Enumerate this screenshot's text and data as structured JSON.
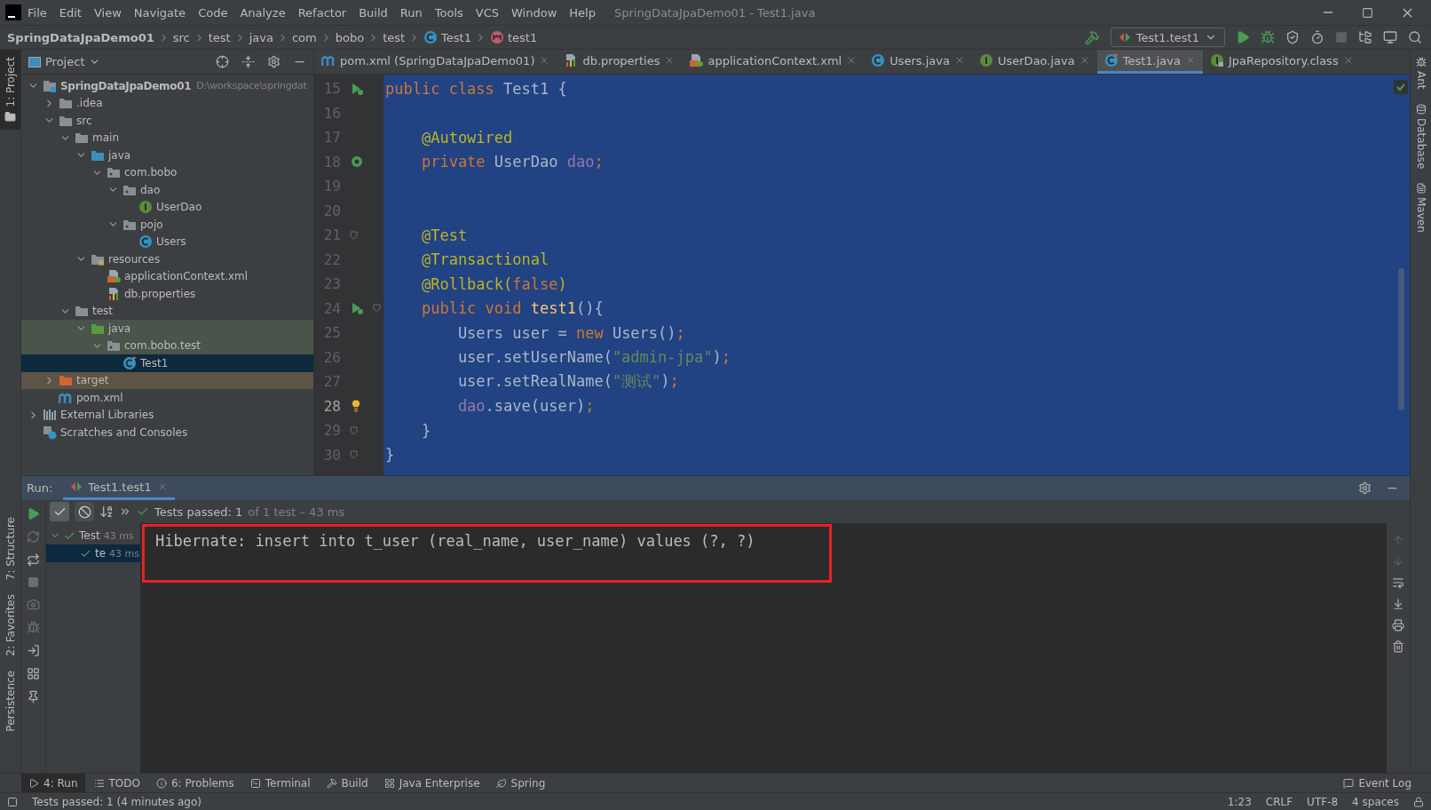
{
  "window": {
    "title": "SpringDataJpaDemo01 - Test1.java"
  },
  "menu": [
    "File",
    "Edit",
    "View",
    "Navigate",
    "Code",
    "Analyze",
    "Refactor",
    "Build",
    "Run",
    "Tools",
    "VCS",
    "Window",
    "Help"
  ],
  "breadcrumb": [
    {
      "label": "SpringDataJpaDemo01",
      "kind": "project"
    },
    {
      "label": "src",
      "kind": "dir"
    },
    {
      "label": "test",
      "kind": "dir"
    },
    {
      "label": "java",
      "kind": "dir"
    },
    {
      "label": "com",
      "kind": "dir"
    },
    {
      "label": "bobo",
      "kind": "dir"
    },
    {
      "label": "test",
      "kind": "dir"
    },
    {
      "label": "Test1",
      "kind": "class"
    },
    {
      "label": "test1",
      "kind": "method"
    }
  ],
  "run_config": {
    "label": "Test1.test1"
  },
  "left_tool_windows": [
    {
      "label": "1: Project",
      "at_bottom": false,
      "selected": true
    },
    {
      "label": "7: Structure",
      "at_bottom": true,
      "selected": false
    },
    {
      "label": "2: Favorites",
      "at_bottom": true,
      "selected": false
    },
    {
      "label": "Persistence",
      "at_bottom": true,
      "selected": false
    }
  ],
  "right_tool_windows": [
    {
      "label": "Ant",
      "kind": "ant"
    },
    {
      "label": "Database",
      "kind": "database"
    },
    {
      "label": "Maven",
      "kind": "maven"
    }
  ],
  "project_panel": {
    "title": "Project",
    "tree": [
      {
        "label": "SpringDataJpaDemo01",
        "hint": "D:\\workspace\\springdat",
        "kind": "module",
        "expanded": true,
        "selected": false,
        "children": [
          {
            "label": ".idea",
            "kind": "folder",
            "expanded": false,
            "selected": false
          },
          {
            "label": "src",
            "kind": "folder",
            "expanded": true,
            "selected": false,
            "children": [
              {
                "label": "main",
                "kind": "folder",
                "expanded": true,
                "selected": false,
                "children": [
                  {
                    "label": "java",
                    "kind": "source-root",
                    "expanded": true,
                    "selected": false,
                    "children": [
                      {
                        "label": "com.bobo",
                        "kind": "package",
                        "expanded": true,
                        "selected": false,
                        "children": [
                          {
                            "label": "dao",
                            "kind": "package",
                            "expanded": true,
                            "selected": false,
                            "children": [
                              {
                                "label": "UserDao",
                                "kind": "interface",
                                "selected": false
                              }
                            ]
                          },
                          {
                            "label": "pojo",
                            "kind": "package",
                            "expanded": true,
                            "selected": false,
                            "children": [
                              {
                                "label": "Users",
                                "kind": "class",
                                "selected": false
                              }
                            ]
                          }
                        ]
                      }
                    ]
                  },
                  {
                    "label": "resources",
                    "kind": "resource-root",
                    "expanded": true,
                    "selected": false,
                    "children": [
                      {
                        "label": "applicationContext.xml",
                        "kind": "xml",
                        "selected": false
                      },
                      {
                        "label": "db.properties",
                        "kind": "properties",
                        "selected": false
                      }
                    ]
                  }
                ]
              },
              {
                "label": "test",
                "kind": "folder",
                "expanded": true,
                "selected": false,
                "children": [
                  {
                    "label": "java",
                    "kind": "test-root",
                    "test_scope": true,
                    "expanded": true,
                    "selected": false,
                    "children": [
                      {
                        "label": "com.bobo.test",
                        "kind": "package",
                        "test_scope": true,
                        "expanded": true,
                        "selected": false,
                        "children": [
                          {
                            "label": "Test1",
                            "kind": "test-class",
                            "selected": true
                          }
                        ]
                      }
                    ]
                  }
                ]
              }
            ]
          },
          {
            "label": "target",
            "kind": "excluded-folder",
            "excluded": true,
            "expanded": false,
            "selected": false
          },
          {
            "label": "pom.xml",
            "kind": "maven",
            "selected": false
          }
        ]
      },
      {
        "label": "External Libraries",
        "kind": "libraries",
        "expanded": false,
        "selected": false
      },
      {
        "label": "Scratches and Consoles",
        "kind": "scratches",
        "selected": false
      }
    ]
  },
  "editor": {
    "tabs": [
      {
        "label": "pom.xml (SpringDataJpaDemo01)",
        "kind": "maven",
        "selected": false
      },
      {
        "label": "db.properties",
        "kind": "properties",
        "selected": false
      },
      {
        "label": "applicationContext.xml",
        "kind": "xml",
        "selected": false
      },
      {
        "label": "Users.java",
        "kind": "class",
        "selected": false
      },
      {
        "label": "UserDao.java",
        "kind": "interface",
        "selected": false
      },
      {
        "label": "Test1.java",
        "kind": "test-class",
        "selected": true
      },
      {
        "label": "JpaRepository.class",
        "kind": "locked-interface",
        "selected": false
      }
    ],
    "lines": [
      {
        "number": "15",
        "run_marker": true,
        "current": false,
        "tokens": [
          {
            "kind": "keyword",
            "text": "public class "
          },
          {
            "kind": "plain",
            "text": "Test1 {"
          }
        ]
      },
      {
        "number": "16",
        "current": false
      },
      {
        "number": "17",
        "current": false,
        "tokens": [
          {
            "kind": "annotation",
            "text": "    @Autowired"
          }
        ]
      },
      {
        "number": "18",
        "bean_marker": true,
        "current": false,
        "tokens": [
          {
            "kind": "keyword",
            "text": "    private "
          },
          {
            "kind": "plain",
            "text": "UserDao "
          },
          {
            "kind": "field",
            "text": "dao"
          },
          {
            "kind": "keyword",
            "text": ";"
          }
        ]
      },
      {
        "number": "19",
        "current": false
      },
      {
        "number": "20",
        "current": false
      },
      {
        "number": "21",
        "fold_marker": true,
        "current": false,
        "tokens": [
          {
            "kind": "annotation",
            "text": "    @Test"
          }
        ]
      },
      {
        "number": "22",
        "current": false,
        "tokens": [
          {
            "kind": "annotation",
            "text": "    @Transactional"
          }
        ]
      },
      {
        "number": "23",
        "current": false,
        "tokens": [
          {
            "kind": "annotation",
            "text": "    @Rollback("
          },
          {
            "kind": "keyword",
            "text": "false"
          },
          {
            "kind": "annotation",
            "text": ")"
          }
        ]
      },
      {
        "number": "24",
        "run_marker": true,
        "fold_marker": true,
        "current": false,
        "tokens": [
          {
            "kind": "keyword",
            "text": "    public void "
          },
          {
            "kind": "method",
            "text": "test1"
          },
          {
            "kind": "plain",
            "text": "(){"
          }
        ]
      },
      {
        "number": "25",
        "current": false,
        "tokens": [
          {
            "kind": "plain",
            "text": "        Users user = "
          },
          {
            "kind": "keyword",
            "text": "new "
          },
          {
            "kind": "plain",
            "text": "Users()"
          },
          {
            "kind": "keyword",
            "text": ";"
          }
        ]
      },
      {
        "number": "26",
        "current": false,
        "tokens": [
          {
            "kind": "plain",
            "text": "        user.setUserName("
          },
          {
            "kind": "string",
            "text": "\"admin-jpa\""
          },
          {
            "kind": "plain",
            "text": ")"
          },
          {
            "kind": "keyword",
            "text": ";"
          }
        ]
      },
      {
        "number": "27",
        "current": false,
        "tokens": [
          {
            "kind": "plain",
            "text": "        user.setRealName("
          },
          {
            "kind": "string",
            "text": "\"测试\""
          },
          {
            "kind": "plain",
            "text": ")"
          },
          {
            "kind": "keyword",
            "text": ";"
          }
        ]
      },
      {
        "number": "28",
        "bulb_marker": true,
        "current": true,
        "tokens": [
          {
            "kind": "field",
            "text": "        dao"
          },
          {
            "kind": "plain",
            "text": ".save(user)"
          },
          {
            "kind": "keyword",
            "text": ";"
          }
        ]
      },
      {
        "number": "29",
        "fold_marker": true,
        "current": false,
        "tokens": [
          {
            "kind": "plain",
            "text": "    }"
          }
        ]
      },
      {
        "number": "30",
        "fold_marker": true,
        "current": false,
        "tokens": [
          {
            "kind": "plain",
            "text": "}"
          }
        ]
      }
    ]
  },
  "run_panel": {
    "label": "Run:",
    "tab": {
      "label": "Test1.test1",
      "selected": true
    },
    "status": {
      "passed": "Tests passed: 1",
      "detail": "of 1 test – 43 ms"
    },
    "tests": [
      {
        "label": "Test",
        "time": "43 ms",
        "expanded": true,
        "selected": false,
        "children": [
          {
            "label": "te",
            "time": "43 ms",
            "selected": true
          }
        ]
      }
    ],
    "console": [
      "Hibernate: insert into t_user (real_name, user_name) values (?, ?)"
    ]
  },
  "bottom_tabs": [
    {
      "label": "4: Run",
      "kind": "run",
      "selected": true
    },
    {
      "label": "TODO",
      "kind": "todo",
      "selected": false
    },
    {
      "label": "6: Problems",
      "kind": "problems",
      "selected": false
    },
    {
      "label": "Terminal",
      "kind": "terminal",
      "selected": false
    },
    {
      "label": "Build",
      "kind": "build",
      "selected": false
    },
    {
      "label": "Java Enterprise",
      "kind": "enterprise",
      "selected": false
    },
    {
      "label": "Spring",
      "kind": "spring",
      "selected": false
    }
  ],
  "event_log": {
    "label": "Event Log"
  },
  "status_bar": {
    "message": "Tests passed: 1 (4 minutes ago)",
    "items": [
      "1:23",
      "CRLF",
      "UTF-8",
      "4 spaces"
    ]
  }
}
